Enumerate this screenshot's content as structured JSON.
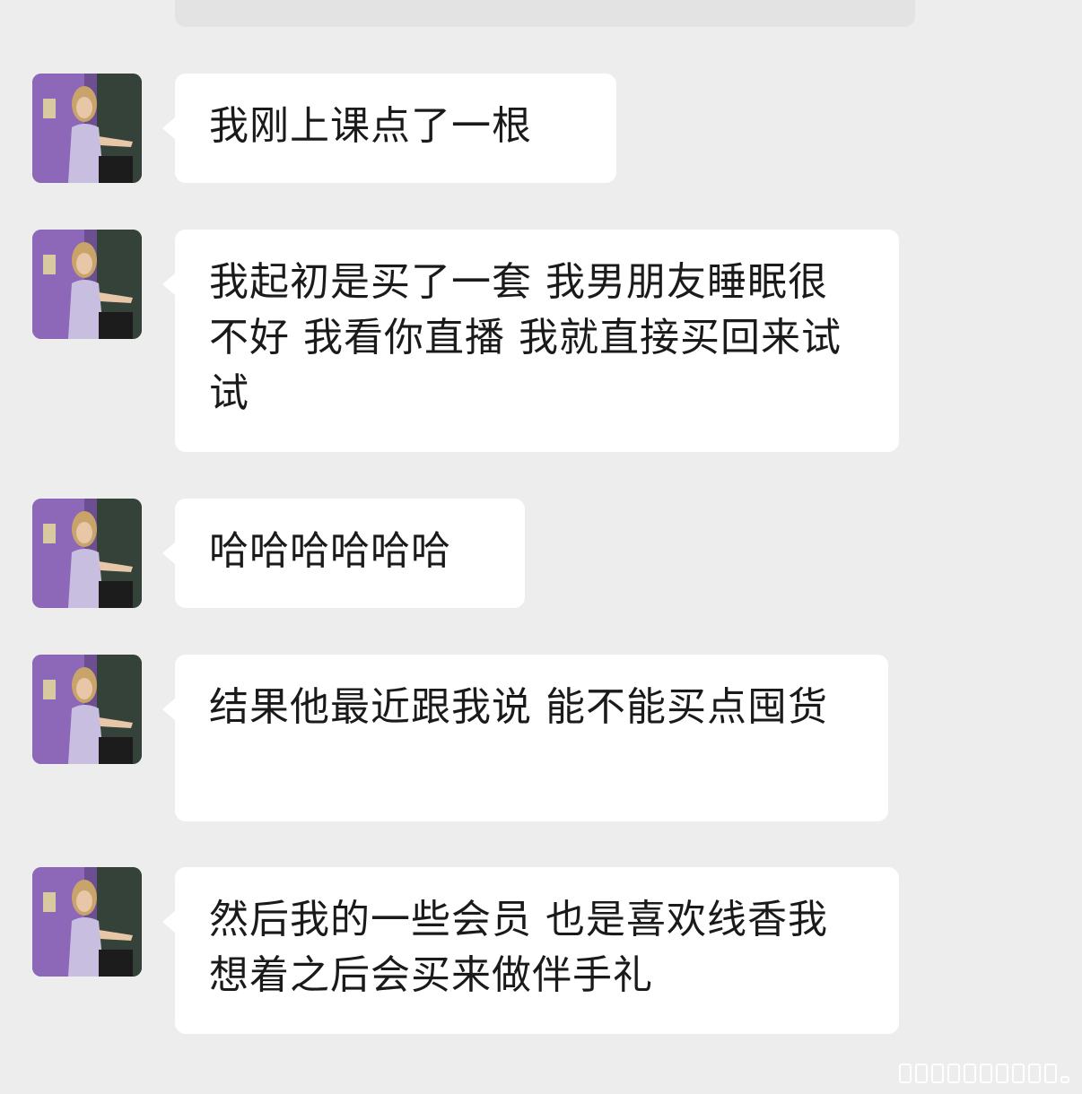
{
  "conversation": {
    "messages": [
      {
        "text": "我刚上课点了一根"
      },
      {
        "text": "我起初是买了一套 我男朋友睡眠很不好 我看你直播 我就直接买回来试试"
      },
      {
        "text": "哈哈哈哈哈哈"
      },
      {
        "text": "结果他最近跟我说 能不能买点囤货"
      },
      {
        "text": "然后我的一些会员 也是喜欢线香我想着之后会买来做伴手礼"
      }
    ]
  },
  "colors": {
    "background": "#ededed",
    "bubble": "#ffffff",
    "text": "#1a1a1a"
  }
}
